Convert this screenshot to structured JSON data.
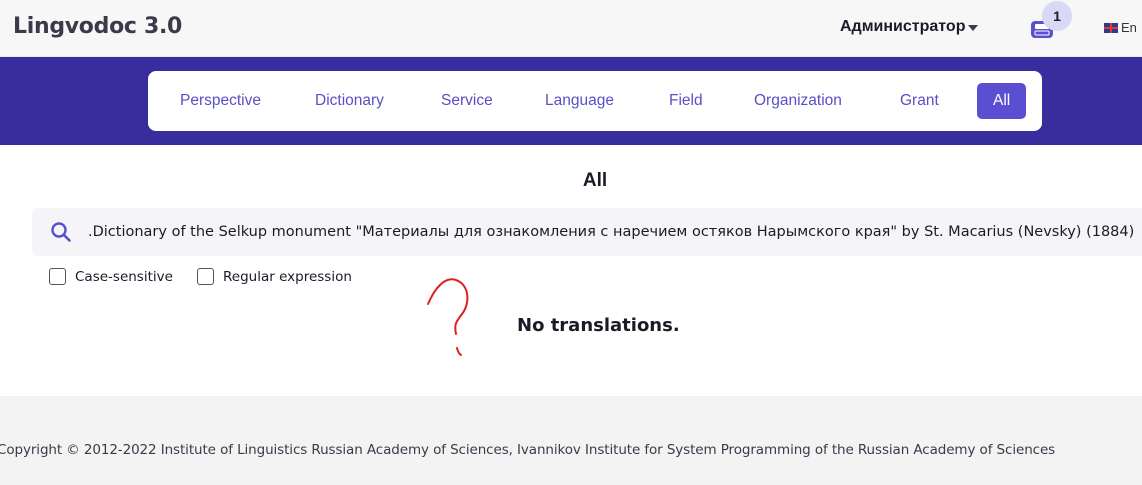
{
  "header": {
    "brand": "Lingvodoc 3.0",
    "user_label": "Администратор",
    "inbox_count": "1",
    "language_label": "En"
  },
  "tabs": [
    {
      "label": "Perspective",
      "active": false
    },
    {
      "label": "Dictionary",
      "active": false
    },
    {
      "label": "Service",
      "active": false
    },
    {
      "label": "Language",
      "active": false
    },
    {
      "label": "Field",
      "active": false
    },
    {
      "label": "Organization",
      "active": false
    },
    {
      "label": "Grant",
      "active": false
    },
    {
      "label": "All",
      "active": true
    }
  ],
  "main": {
    "title": "All",
    "search_value": "Dictionary of the Selkup monument \"Материалы для ознакомления с наречием остяков Нарымского края\" by St. Macarius (Nevsky) (1884).",
    "case_sensitive_label": "Case-sensitive",
    "regex_label": "Regular expression",
    "empty_message": "No translations."
  },
  "footer": {
    "copyright": "Copyright © 2012-2022  Institute of Linguistics Russian Academy of Sciences, Ivannikov Institute for System Programming of the Russian Academy of Sciences"
  },
  "colors": {
    "brand_band": "#372d9d",
    "accent": "#5a4fd0",
    "tab_text": "#5a4fc4",
    "annotation": "#e02020"
  },
  "icons": [
    "search-icon",
    "inbox-icon",
    "chevron-down-icon",
    "uk-flag-icon",
    "question-mark-annotation"
  ]
}
